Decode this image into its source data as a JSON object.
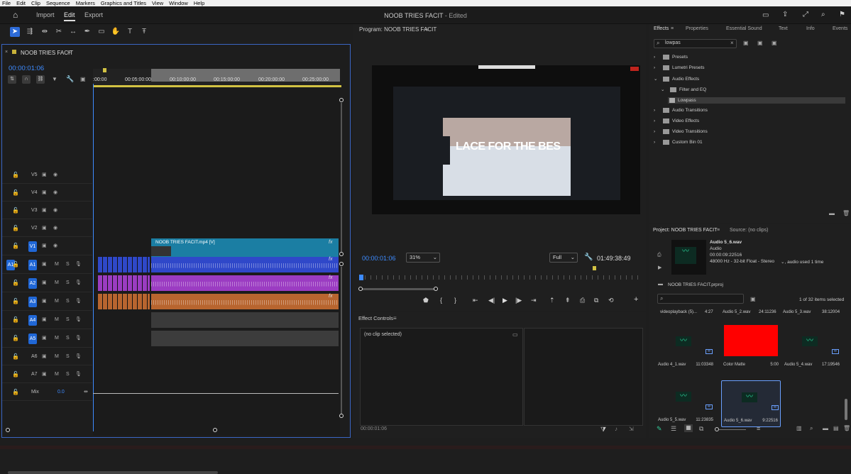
{
  "menubar": [
    "File",
    "Edit",
    "Clip",
    "Sequence",
    "Markers",
    "Graphics and Titles",
    "View",
    "Window",
    "Help"
  ],
  "header": {
    "tabs": [
      {
        "label": "Import"
      },
      {
        "label": "Edit",
        "active": true
      },
      {
        "label": "Export"
      }
    ],
    "title": "NOOB TRIES FACIT",
    "title_suffix": "- Edited"
  },
  "timeline": {
    "sequence_name": "NOOB TRIES FACIT",
    "timecode": "00:00:01:06",
    "ruler_ticks": [
      ":00:00",
      "00:05:00:00",
      "00:10:00:00",
      "00:15:00:00",
      "00:20:00:00",
      "00:25:00:00"
    ],
    "tracks": [
      {
        "name": "V5",
        "kind": "video"
      },
      {
        "name": "V4",
        "kind": "video"
      },
      {
        "name": "V3",
        "kind": "video"
      },
      {
        "name": "V2",
        "kind": "video"
      },
      {
        "name": "V1",
        "kind": "video",
        "target": true
      },
      {
        "name": "A1",
        "kind": "audio",
        "target": true,
        "source": "A1"
      },
      {
        "name": "A2",
        "kind": "audio",
        "target": true
      },
      {
        "name": "A3",
        "kind": "audio",
        "target": true
      },
      {
        "name": "A4",
        "kind": "audio",
        "target": true
      },
      {
        "name": "A5",
        "kind": "audio",
        "target": true
      },
      {
        "name": "A6",
        "kind": "audio"
      },
      {
        "name": "A7",
        "kind": "audio"
      }
    ],
    "mix_label": "Mix",
    "mix_value": "0.0",
    "m_label": "M",
    "s_label": "S",
    "v1_clip_label": "NOOB TRIES FACIT.mp4 [V]",
    "fx_label": "fx",
    "colors": {
      "v1": "#1b7ea3",
      "a1": "#2f48c9",
      "a2": "#9b3cc2",
      "a3": "#b8652f",
      "a4": "#3a3a3a",
      "a5": "#3c3c3c",
      "playhead": "#3d8bff"
    }
  },
  "program": {
    "title": "Program: NOOB TRIES FACIT",
    "timecode": "00:00:01:06",
    "zoom": "31%",
    "quality": "Full",
    "duration": "01:49:38:49",
    "overlay_text": "LACE FOR THE BES"
  },
  "effect_controls": {
    "title": "Effect Controls",
    "noclip": "(no clip selected)",
    "timecode": "00:00:01:06"
  },
  "effects": {
    "tabs": [
      "Effects",
      "Properties",
      "Essential Sound",
      "Text",
      "Info",
      "Events"
    ],
    "search": "lowpas",
    "tree": [
      {
        "label": "Presets",
        "depth": 0,
        "expanded": false
      },
      {
        "label": "Lumetri Presets",
        "depth": 0,
        "expanded": false
      },
      {
        "label": "Audio Effects",
        "depth": 0,
        "expanded": true
      },
      {
        "label": "Filter and EQ",
        "depth": 1,
        "expanded": true
      },
      {
        "label": "Lowpass",
        "depth": 2,
        "leaf": true
      },
      {
        "label": "Audio Transitions",
        "depth": 0,
        "expanded": false
      },
      {
        "label": "Video Effects",
        "depth": 0,
        "expanded": false
      },
      {
        "label": "Video Transitions",
        "depth": 0,
        "expanded": false
      },
      {
        "label": "Custom Bin 01",
        "depth": 0,
        "expanded": false
      }
    ]
  },
  "project": {
    "title": "Project: NOOB TRIES FACIT",
    "source": "Source: (no clips)",
    "clip_name": "Audio 5_6.wav",
    "clip_type": "Audio",
    "clip_duration": "00:00:09:22516",
    "clip_format": "48000 Hz - 32-bit Float - Stereo",
    "clip_usage": "audio used 1 time",
    "file": "NOOB TRIES FACIT.prproj",
    "count": "1 of 32 items selected",
    "header_row": [
      {
        "name": "videoplayback (5)...",
        "dur": "4:27"
      },
      {
        "name": "Audio 5_2.wav",
        "dur": "24:11236"
      },
      {
        "name": "Audio 5_3.wav",
        "dur": "38:12004"
      }
    ],
    "items": [
      {
        "name": "Audio 4_1.wav",
        "dur": "11:03348",
        "kind": "audio"
      },
      {
        "name": "Color Matte",
        "dur": "5:00",
        "kind": "matte",
        "color": "#ff0000"
      },
      {
        "name": "Audio 5_4.wav",
        "dur": "17:19546",
        "kind": "audio"
      },
      {
        "name": "Audio 5_5.wav",
        "dur": "11:23835",
        "kind": "audio"
      },
      {
        "name": "Audio 5_6.wav",
        "dur": "9:22516",
        "kind": "audio",
        "selected": true
      }
    ]
  }
}
